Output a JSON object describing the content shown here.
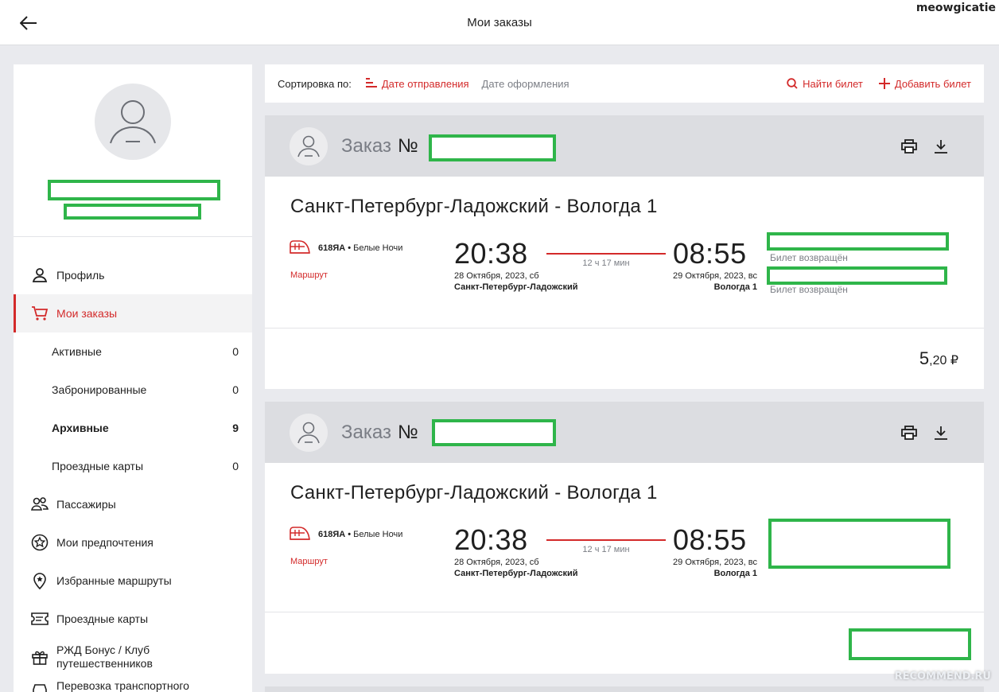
{
  "header": {
    "title": "Мои заказы",
    "username": "meowgicatie"
  },
  "sidebar": {
    "items": [
      {
        "label": "Профиль",
        "icon": "user-icon"
      },
      {
        "label": "Мои заказы",
        "icon": "cart-icon",
        "active": true
      },
      {
        "label": "Пассажиры",
        "icon": "users-icon"
      },
      {
        "label": "Мои предпочтения",
        "icon": "star-icon"
      },
      {
        "label": "Избранные маршруты",
        "icon": "map-pin-icon"
      },
      {
        "label": "Проездные карты",
        "icon": "ticket-icon"
      },
      {
        "label": "РЖД Бонус / Клуб путешественников",
        "icon": "gift-icon"
      },
      {
        "label": "Перевозка транспортного",
        "icon": "car-icon"
      }
    ],
    "orders_sub": [
      {
        "label": "Активные",
        "count": "0"
      },
      {
        "label": "Забронированные",
        "count": "0"
      },
      {
        "label": "Архивные",
        "count": "9"
      },
      {
        "label": "Проездные карты",
        "count": "0"
      }
    ]
  },
  "sort": {
    "label": "Сортировка по:",
    "active": "Дате отправления",
    "other": "Дате оформления",
    "find": "Найти билет",
    "add": "Добавить билет"
  },
  "orders": [
    {
      "title": "Заказ",
      "number_prefix": "№",
      "route": "Санкт-Петербург-Ладожский - Вологда 1",
      "train_number": "618ЯА",
      "train_name": "Белые Ночи",
      "route_link": "Маршрут",
      "dep_time": "20:38",
      "dep_date": "28 Октября, 2023, сб",
      "dep_station": "Санкт-Петербург-Ладожский",
      "duration": "12 ч 17 мин",
      "arr_time": "08:55",
      "arr_date": "29 Октября, 2023, вс",
      "arr_station": "Вологда 1",
      "ticket_statuses": [
        "Билет возвращён",
        "Билет возвращён"
      ],
      "price_int": "5",
      "price_frac": ",20 ₽"
    },
    {
      "title": "Заказ",
      "number_prefix": "№",
      "route": "Санкт-Петербург-Ладожский - Вологда 1",
      "train_number": "618ЯА",
      "train_name": "Белые Ночи",
      "route_link": "Маршрут",
      "dep_time": "20:38",
      "dep_date": "28 Октября, 2023, сб",
      "dep_station": "Санкт-Петербург-Ладожский",
      "duration": "12 ч 17 мин",
      "arr_time": "08:55",
      "arr_date": "29 Октября, 2023, вс",
      "arr_station": "Вологда 1"
    }
  ],
  "watermark": "RECOMMEND.RU",
  "colors": {
    "accent": "#d32a2a",
    "redaction": "#2fb54a",
    "header_band": "#dcdde1"
  }
}
